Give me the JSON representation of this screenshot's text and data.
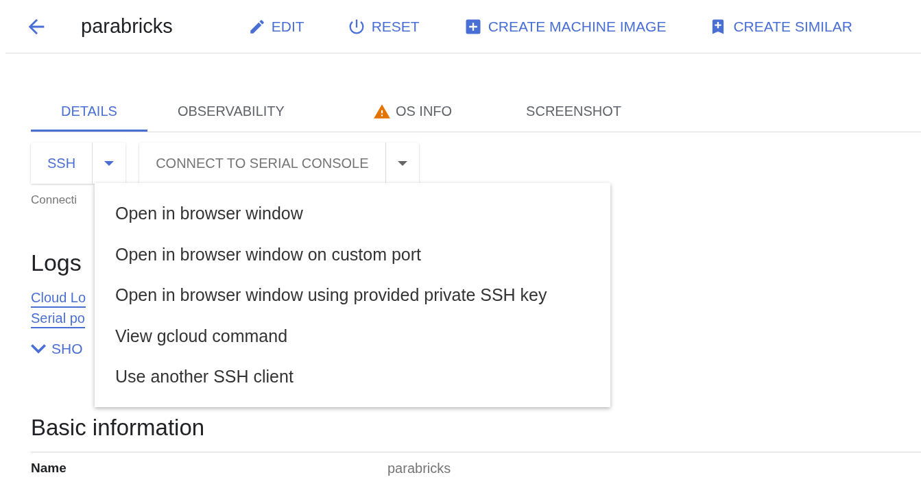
{
  "header": {
    "title": "parabricks",
    "actions": [
      {
        "kind": "edit",
        "label": "EDIT"
      },
      {
        "kind": "reset",
        "label": "RESET"
      },
      {
        "kind": "add",
        "label": "CREATE MACHINE IMAGE"
      },
      {
        "kind": "bookmark-add",
        "label": "CREATE SIMILAR"
      }
    ]
  },
  "tabs": [
    {
      "label": "DETAILS",
      "selected": true,
      "warning": false
    },
    {
      "label": "OBSERVABILITY",
      "selected": false,
      "warning": false
    },
    {
      "label": "OS INFO",
      "selected": false,
      "warning": true
    },
    {
      "label": "SCREENSHOT",
      "selected": false,
      "warning": false
    }
  ],
  "connect_buttons": [
    {
      "label": "SSH",
      "primary": true
    },
    {
      "label": "CONNECT TO SERIAL CONSOLE",
      "primary": false
    }
  ],
  "status_text": "Connecti",
  "logs": {
    "title": "Logs",
    "links": [
      "Cloud Lo",
      "Serial po"
    ],
    "show_more": "SHO"
  },
  "ssh_menu": [
    "Open in browser window",
    "Open in browser window on custom port",
    "Open in browser window using provided private SSH key",
    "View gcloud command",
    "Use another SSH client"
  ],
  "basic_information": {
    "title": "Basic information",
    "rows": [
      {
        "label": "Name",
        "value": "parabricks"
      }
    ]
  }
}
